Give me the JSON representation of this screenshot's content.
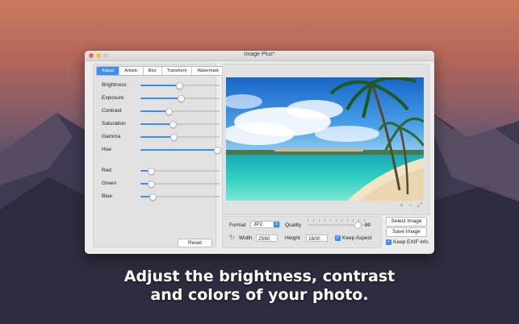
{
  "window": {
    "title": "Image Plus*"
  },
  "tabs": [
    "Adjust",
    "Artistic",
    "Blur",
    "Transform",
    "Watermark"
  ],
  "active_tab": "Adjust",
  "sliders": [
    {
      "label": "Brightness",
      "value": 0.48
    },
    {
      "label": "Exposure",
      "value": 0.5
    },
    {
      "label": "Contrast",
      "value": 0.35
    },
    {
      "label": "Saturation",
      "value": 0.4
    },
    {
      "label": "Gamma",
      "value": 0.41
    },
    {
      "label": "Hue",
      "value": 0.96
    }
  ],
  "color_sliders": [
    {
      "label": "Red",
      "value": 0.13
    },
    {
      "label": "Green",
      "value": 0.13
    },
    {
      "label": "Blue",
      "value": 0.15
    }
  ],
  "reset_label": "Reset",
  "zoom_controls": {
    "zoom_in": "+",
    "zoom_out": "−",
    "fit": "⤢"
  },
  "export": {
    "format_label": "Format",
    "format_value": "JP2",
    "quality_label": "Quality",
    "quality_value": "80",
    "quality_fraction": 0.8,
    "width_label": "Width",
    "width_value": "2560",
    "height_label": "Height",
    "height_value": "1600",
    "keep_aspect_label": "Keep Aspect",
    "keep_aspect_checked": true
  },
  "buttons": {
    "select_image": "Select Image",
    "save_image": "Save Image",
    "keep_exif_label": "Keep EXIF info",
    "keep_exif_checked": true
  },
  "caption": {
    "line1": "Adjust the brightness, contrast",
    "line2": "and colors of your photo."
  },
  "colors": {
    "accent": "#3b8ef6"
  }
}
